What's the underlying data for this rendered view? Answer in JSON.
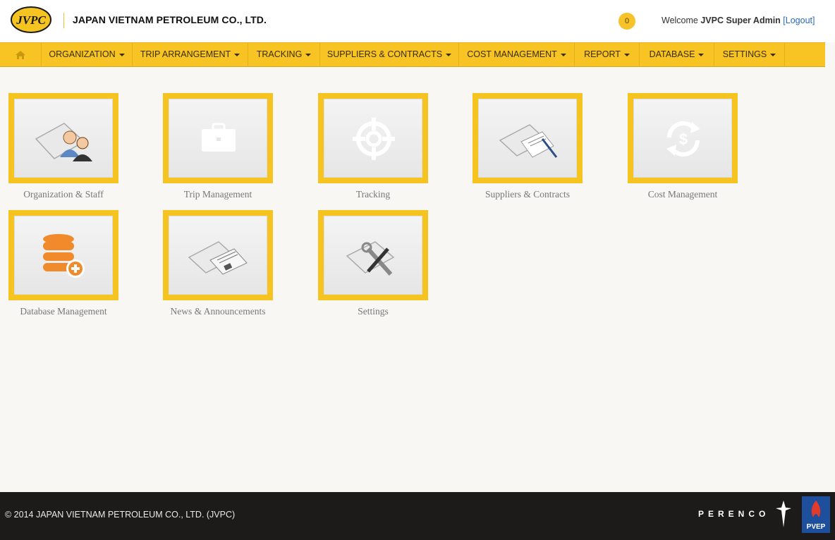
{
  "header": {
    "logo_text": "JVPC",
    "company_name": "JAPAN VIETNAM PETROLEUM CO., LTD.",
    "notification_count": "0",
    "welcome_prefix": "Welcome",
    "user_name": "JVPC Super Admin",
    "logout_label": "[Logout]"
  },
  "nav": {
    "home_icon": "home-icon",
    "items": [
      {
        "label": "ORGANIZATION"
      },
      {
        "label": "TRIP ARRANGEMENT"
      },
      {
        "label": "TRACKING"
      },
      {
        "label": "SUPPLIERS & CONTRACTS"
      },
      {
        "label": "COST MANAGEMENT"
      },
      {
        "label": "REPORT"
      },
      {
        "label": "DATABASE"
      },
      {
        "label": "SETTINGS"
      }
    ]
  },
  "tiles": [
    {
      "label": "Organization & Staff",
      "icon": "people-icon"
    },
    {
      "label": "Trip Management",
      "icon": "briefcase-icon"
    },
    {
      "label": "Tracking",
      "icon": "target-icon"
    },
    {
      "label": "Suppliers & Contracts",
      "icon": "contract-icon"
    },
    {
      "label": "Cost Management",
      "icon": "dollar-refresh-icon"
    },
    {
      "label": "Database Management",
      "icon": "database-add-icon"
    },
    {
      "label": "News & Announcements",
      "icon": "newspaper-icon"
    },
    {
      "label": "Settings",
      "icon": "tools-icon"
    }
  ],
  "footer": {
    "copyright": "© 2014 JAPAN VIETNAM PETROLEUM CO., LTD. (JVPC)",
    "partner1": "PERENCO",
    "partner2": "PVEP"
  },
  "colors": {
    "accent": "#f8c424",
    "footer_bg": "#1c1b19",
    "page_bg": "#f8f7f4"
  }
}
